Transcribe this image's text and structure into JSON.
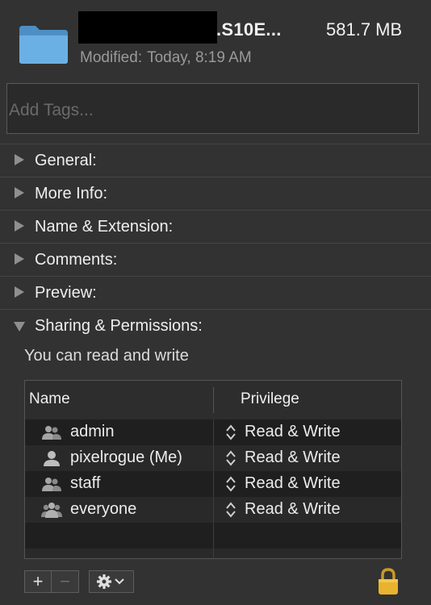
{
  "header": {
    "filename": ".S10E...",
    "filesize": "581.7 MB",
    "modified_label": "Modified:",
    "modified_value": "Today, 8:19 AM"
  },
  "tags": {
    "placeholder": "Add Tags..."
  },
  "sections": [
    {
      "label": "General:",
      "expanded": false
    },
    {
      "label": "More Info:",
      "expanded": false
    },
    {
      "label": "Name & Extension:",
      "expanded": false
    },
    {
      "label": "Comments:",
      "expanded": false
    },
    {
      "label": "Preview:",
      "expanded": false
    },
    {
      "label": "Sharing & Permissions:",
      "expanded": true
    }
  ],
  "permissions": {
    "summary": "You can read and write",
    "columns": {
      "name": "Name",
      "privilege": "Privilege"
    },
    "rows": [
      {
        "name": "admin",
        "privilege": "Read & Write",
        "icon": "group-icon"
      },
      {
        "name": "pixelrogue (Me)",
        "privilege": "Read & Write",
        "icon": "user-icon"
      },
      {
        "name": "staff",
        "privilege": "Read & Write",
        "icon": "group-icon"
      },
      {
        "name": "everyone",
        "privilege": "Read & Write",
        "icon": "everyone-icon"
      }
    ]
  },
  "toolbar": {
    "add": "+",
    "remove": "−"
  },
  "colors": {
    "background": "#323232",
    "folder": "#5aa0d6",
    "lock": "#e8b32e"
  }
}
